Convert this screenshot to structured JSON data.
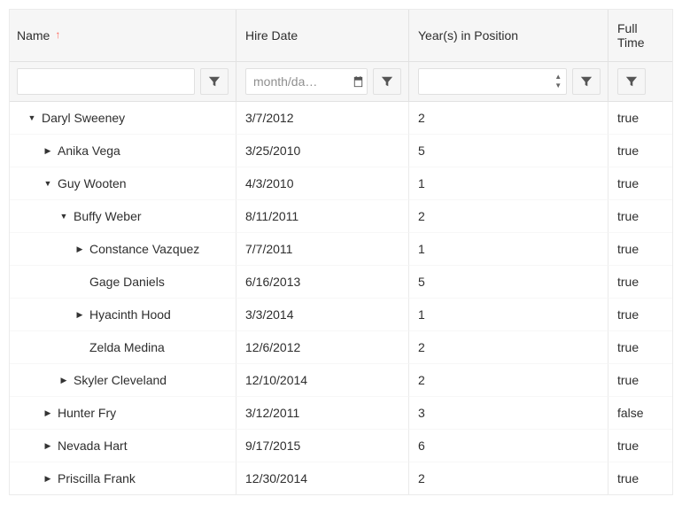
{
  "columns": {
    "name": {
      "label": "Name",
      "sortedAsc": true
    },
    "hire": {
      "label": "Hire Date"
    },
    "years": {
      "label": "Year(s) in Position"
    },
    "full": {
      "label": "Full Time"
    }
  },
  "filters": {
    "name": {
      "value": ""
    },
    "hire": {
      "value": "",
      "placeholder": "month/da…"
    },
    "years": {
      "value": ""
    }
  },
  "rows": [
    {
      "indent": 0,
      "expander": "open",
      "name": "Daryl Sweeney",
      "hire": "3/7/2012",
      "years": "2",
      "fulltime": "true"
    },
    {
      "indent": 1,
      "expander": "closed",
      "name": "Anika Vega",
      "hire": "3/25/2010",
      "years": "5",
      "fulltime": "true"
    },
    {
      "indent": 1,
      "expander": "open",
      "name": "Guy Wooten",
      "hire": "4/3/2010",
      "years": "1",
      "fulltime": "true"
    },
    {
      "indent": 2,
      "expander": "open",
      "name": "Buffy Weber",
      "hire": "8/11/2011",
      "years": "2",
      "fulltime": "true"
    },
    {
      "indent": 3,
      "expander": "closed",
      "name": "Constance Vazquez",
      "hire": "7/7/2011",
      "years": "1",
      "fulltime": "true"
    },
    {
      "indent": 3,
      "expander": "none",
      "name": "Gage Daniels",
      "hire": "6/16/2013",
      "years": "5",
      "fulltime": "true"
    },
    {
      "indent": 3,
      "expander": "closed",
      "name": "Hyacinth Hood",
      "hire": "3/3/2014",
      "years": "1",
      "fulltime": "true"
    },
    {
      "indent": 3,
      "expander": "none",
      "name": "Zelda Medina",
      "hire": "12/6/2012",
      "years": "2",
      "fulltime": "true"
    },
    {
      "indent": 2,
      "expander": "closed",
      "name": "Skyler Cleveland",
      "hire": "12/10/2014",
      "years": "2",
      "fulltime": "true"
    },
    {
      "indent": 1,
      "expander": "closed",
      "name": "Hunter Fry",
      "hire": "3/12/2011",
      "years": "3",
      "fulltime": "false"
    },
    {
      "indent": 1,
      "expander": "closed",
      "name": "Nevada Hart",
      "hire": "9/17/2015",
      "years": "6",
      "fulltime": "true"
    },
    {
      "indent": 1,
      "expander": "closed",
      "name": "Priscilla Frank",
      "hire": "12/30/2014",
      "years": "2",
      "fulltime": "true"
    }
  ]
}
